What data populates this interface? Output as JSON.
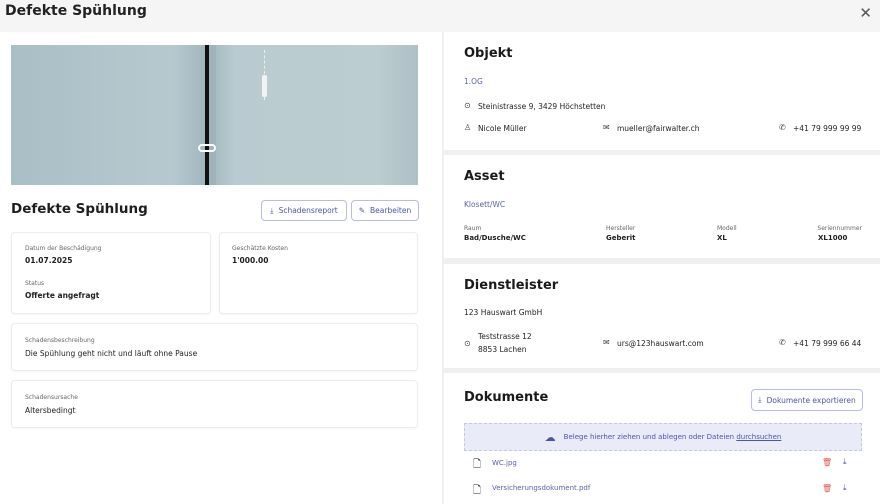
{
  "header": {
    "title": "Defekte Spühlung",
    "close_icon": "close-icon"
  },
  "left": {
    "title": "Defekte Spühlung",
    "buttons": {
      "report": "Schadensreport",
      "edit": "Bearbeiten"
    },
    "damage_date": {
      "label": "Datum der Beschädigung",
      "value": "01.07.2025"
    },
    "status": {
      "label": "Status",
      "value": "Offerte angefragt"
    },
    "cost": {
      "label": "Geschätzte Kosten",
      "value": "1'000.00"
    },
    "description": {
      "label": "Schadensbeschreibung",
      "value": "Die Spühlung geht nicht und läuft ohne Pause"
    },
    "cause": {
      "label": "Schadensursache",
      "value": "Altersbedingt"
    }
  },
  "objekt": {
    "title": "Objekt",
    "unit": "1.OG",
    "address": "Steinistrasse 9, 3429 Höchstetten",
    "person": "Nicole Müller",
    "email": "mueller@fairwalter.ch",
    "phone": "+41 79 999 99 99"
  },
  "asset": {
    "title": "Asset",
    "name": "Klosett/WC",
    "fields": [
      {
        "label": "Raum",
        "value": "Bad/Dusche/WC"
      },
      {
        "label": "Hersteller",
        "value": "Geberit"
      },
      {
        "label": "Modell",
        "value": "XL"
      },
      {
        "label": "Seriennummer",
        "value": "XL1000"
      }
    ]
  },
  "dienstleister": {
    "title": "Dienstleister",
    "name": "123 Hauswart GmbH",
    "street": "Teststrasse 12",
    "city": "8853 Lachen",
    "email": "urs@123hauswart.com",
    "phone": "+41 79 999 66 44"
  },
  "dokumente": {
    "title": "Dokumente",
    "export": "Dokumente exportieren",
    "drop_text": "Belege hierher ziehen und ablegen oder Dateien",
    "drop_link": "durchsuchen",
    "files": [
      {
        "name": "WC.jpg"
      },
      {
        "name": "Versicherungsdokument.pdf"
      }
    ]
  },
  "colors": {
    "accent": "#4a55a8",
    "delete": "#e05555"
  }
}
